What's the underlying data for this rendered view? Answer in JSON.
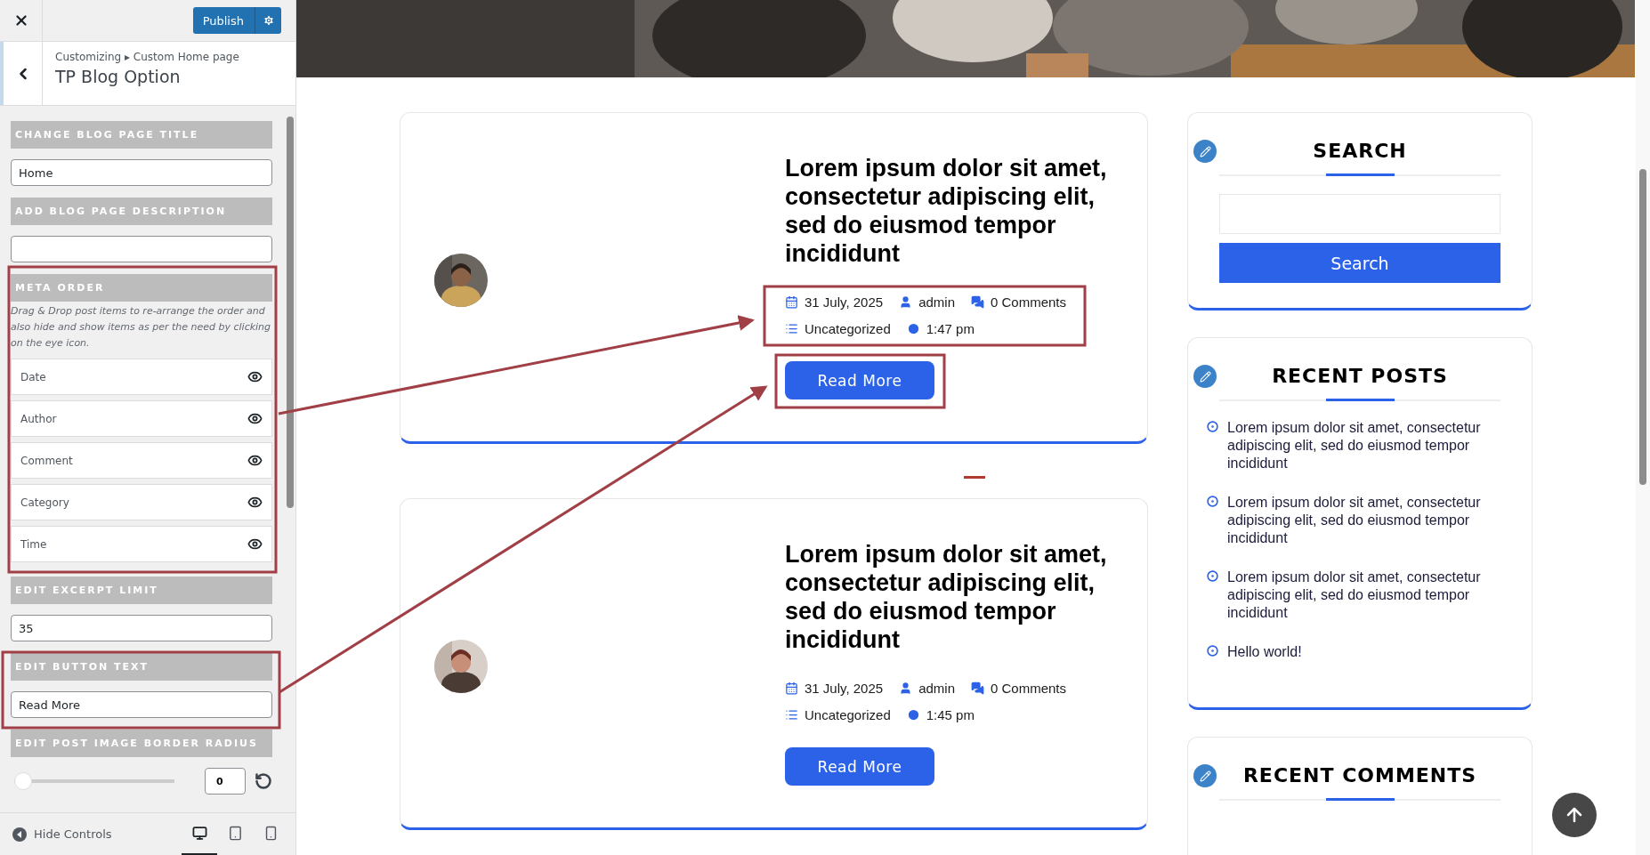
{
  "customizer": {
    "publish": "Publish",
    "breadcrumb": {
      "root": "Customizing",
      "separator": "▸",
      "parent": "Custom Home page"
    },
    "title": "TP Blog Option",
    "sections": [
      {
        "kind": "text",
        "label": "CHANGE BLOG PAGE TITLE",
        "value": "Home"
      },
      {
        "kind": "text",
        "label": "ADD BLOG PAGE DESCRIPTION"
      },
      {
        "kind": "meta",
        "label": "META ORDER",
        "description": "Drag & Drop post items to re-arrange the order and also hide and show items as per the need by clicking on the eye icon.",
        "items": [
          {
            "label": "Date",
            "visible": true
          },
          {
            "label": "Author",
            "visible": true
          },
          {
            "label": "Comment",
            "visible": true
          },
          {
            "label": "Category",
            "visible": true
          },
          {
            "label": "Time",
            "visible": true
          }
        ]
      },
      {
        "kind": "text",
        "label": "EDIT EXCERPT LIMIT",
        "value": "35"
      },
      {
        "kind": "text",
        "label": "EDIT BUTTON TEXT",
        "value": "Read More"
      },
      {
        "kind": "slider",
        "label": "EDIT POST IMAGE BORDER RADIUS",
        "level": 0,
        "value": "0"
      }
    ],
    "hide_controls": "Hide Controls",
    "devices": [
      {
        "kind": "desktop",
        "selected": true
      },
      {
        "kind": "tablet",
        "selected": false
      },
      {
        "kind": "mobile",
        "selected": false
      }
    ]
  },
  "preview": {
    "posts": [
      {
        "title": "Lorem ipsum dolor sit amet, consectetur adipiscing elit, sed do eiusmod tempor incididunt",
        "date": "31 July, 2025",
        "author": "admin",
        "comments": "0 Comments",
        "category": "Uncategorized",
        "time": "1:47 pm",
        "button": "Read More"
      },
      {
        "title": "Lorem ipsum dolor sit amet, consectetur adipiscing elit, sed do eiusmod tempor incididunt",
        "date": "31 July, 2025",
        "author": "admin",
        "comments": "0 Comments",
        "category": "Uncategorized",
        "time": "1:45 pm",
        "button": "Read More"
      }
    ],
    "widgets": [
      {
        "kind": "search",
        "title": "SEARCH",
        "button": "Search"
      },
      {
        "kind": "list",
        "title": "RECENT POSTS",
        "items": [
          "Lorem ipsum dolor sit amet, consectetur adipiscing elit, sed do eiusmod tempor incididunt",
          "Lorem ipsum dolor sit amet, consectetur adipiscing elit, sed do eiusmod tempor incididunt",
          "Lorem ipsum dolor sit amet, consectetur adipiscing elit, sed do eiusmod tempor incididunt",
          "Hello world!"
        ]
      },
      {
        "kind": "list",
        "title": "RECENT COMMENTS"
      }
    ]
  }
}
